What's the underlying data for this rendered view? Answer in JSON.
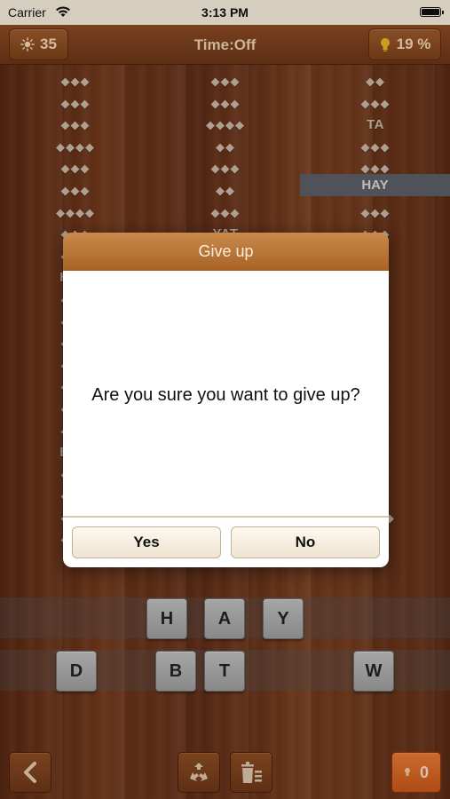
{
  "status_bar": {
    "carrier": "Carrier",
    "time": "3:13 PM"
  },
  "top_bar": {
    "score": "35",
    "timer": "Time:Off",
    "progress": "19 %"
  },
  "columns": {
    "left": [
      "◆◆◆",
      "◆◆◆",
      "◆◆◆",
      "◆◆◆◆",
      "◆◆◆",
      "◆◆◆",
      "◆◆◆◆",
      "◆◆◆",
      "◆◆◆",
      "H◆◆",
      "◆◆◆",
      "◆◆◆",
      "◆◆◆",
      "◆◆◆",
      "◆◆◆",
      "◆◆◆",
      "◆◆◆",
      "B◆◆",
      "◆◆◆",
      "◆◆◆",
      "◆◆◆",
      "◆◆◆"
    ],
    "mid": [
      "◆◆◆",
      "◆◆◆",
      "◆◆◆◆",
      "◆◆",
      "◆◆◆",
      "◆◆",
      "◆◆◆",
      "YAT"
    ],
    "right": [
      "◆◆",
      "◆◆◆",
      "TA",
      "◆◆◆",
      "◆◆◆",
      "HAY",
      "◆◆◆",
      "◆◆◆",
      "◆◆◆",
      "◆◆◆",
      "◆◆◆",
      "◆◆◆",
      "◆◆◆",
      "◆◆◆",
      "◆◆◆",
      "◆◆◆",
      "◆◆◆",
      "◆◆◆",
      "◆◆◆",
      "◆◆◆",
      "◆◆◆◆",
      "◆◆◆"
    ],
    "highlighted_word": "HAY"
  },
  "tiles_row1": [
    "H",
    "A",
    "Y"
  ],
  "tiles_row2": [
    "D",
    "B",
    "T",
    "W"
  ],
  "bottom_bar": {
    "hints_count": "0"
  },
  "dialog": {
    "title": "Give up",
    "message": "Are you sure you want to give up?",
    "yes_label": "Yes",
    "no_label": "No"
  },
  "colors": {
    "accent_orange": "#d8642a",
    "wood_dark": "#5e2c14",
    "dialog_header": "#b8753a"
  },
  "icons": [
    "wifi-icon",
    "battery-icon",
    "sun-icon",
    "bulb-icon",
    "back-arrow-icon",
    "shuffle-icon",
    "clear-icon",
    "hint-icon"
  ]
}
